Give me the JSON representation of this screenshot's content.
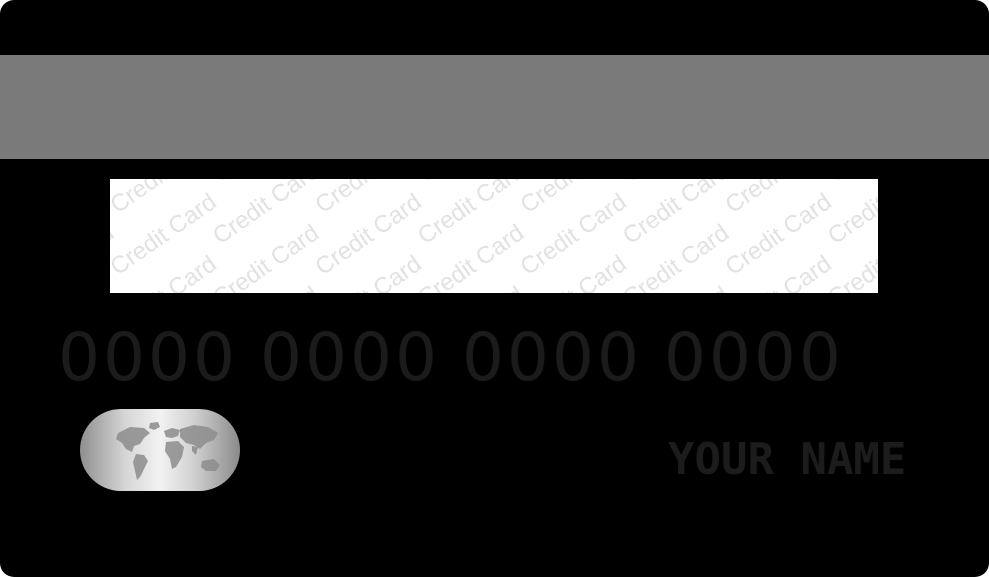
{
  "card": {
    "card_color": "#000000",
    "stripe_color": "#7a7a7a",
    "signature_panel": {
      "background_color": "#ffffff",
      "pattern_text": "Credit Card",
      "pattern_color": "#e2e2e2"
    },
    "number_groups": [
      "0000",
      "0000",
      "0000",
      "0000"
    ],
    "number_color": "#1b1b1b",
    "holder_name": "YOUR NAME",
    "holder_name_color": "#1c1c1c",
    "emblem": {
      "icon": "world-map-icon",
      "color": "silver"
    }
  }
}
